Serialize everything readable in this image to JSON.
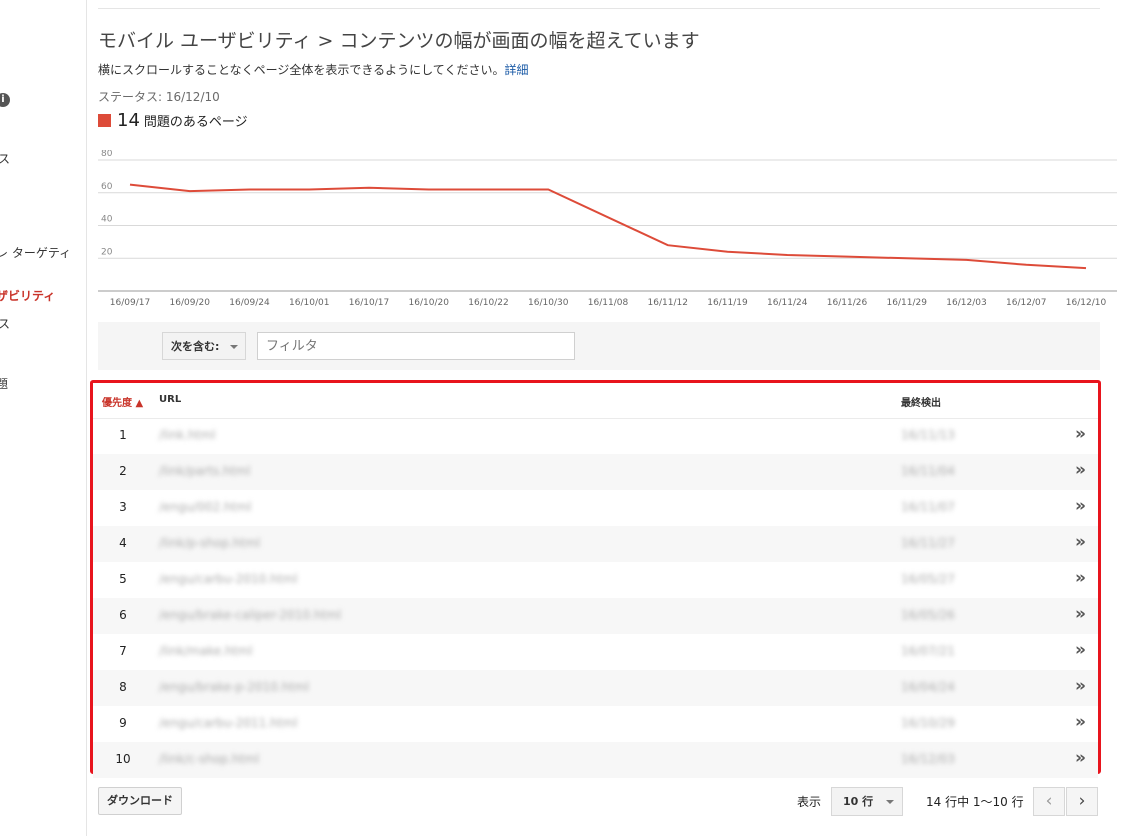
{
  "sidebar": {
    "items": [
      {
        "label": "ス"
      },
      {
        "label": "レ ターゲティ"
      },
      {
        "label": "ザビリティ"
      },
      {
        "label": "ス"
      },
      {
        "label": "題"
      }
    ]
  },
  "page": {
    "title": "モバイル ユーザビリティ > コンテンツの幅が画面の幅を超えています",
    "description": "横にスクロールすることなくページ全体を表示できるようにしてください。",
    "details_link": "詳細",
    "status": "ステータス: 16/12/10",
    "issue_count": "14",
    "issue_label": "問題のあるページ",
    "issue_color": "#dd4b39"
  },
  "chart_data": {
    "type": "line",
    "x": [
      "16/09/17",
      "16/09/20",
      "16/09/24",
      "16/10/01",
      "16/10/17",
      "16/10/20",
      "16/10/22",
      "16/10/30",
      "16/11/08",
      "16/11/12",
      "16/11/19",
      "16/11/24",
      "16/11/26",
      "16/11/29",
      "16/12/03",
      "16/12/07",
      "16/12/10"
    ],
    "series": [
      {
        "values": [
          65,
          61,
          62,
          62,
          63,
          62,
          62,
          62,
          null,
          28,
          24,
          22,
          21,
          20,
          19,
          16,
          14
        ]
      }
    ],
    "yticks": [
      20,
      40,
      60,
      80
    ],
    "ylim": [
      0,
      80
    ],
    "grid": true,
    "color": "#dd4b39"
  },
  "filter": {
    "select_label": "次を含む:",
    "input_placeholder": "フィルタ"
  },
  "table": {
    "columns": {
      "priority": "優先度 ▲",
      "url": "URL",
      "last_detected": "最終検出"
    },
    "rows": [
      {
        "priority": "1",
        "url": "/link.html",
        "date": "16/11/13"
      },
      {
        "priority": "2",
        "url": "/link/parts.html",
        "date": "16/11/04"
      },
      {
        "priority": "3",
        "url": "/engu/002.html",
        "date": "16/11/07"
      },
      {
        "priority": "4",
        "url": "/link/p-shop.html",
        "date": "16/11/27"
      },
      {
        "priority": "5",
        "url": "/engu/carbu-2010.html",
        "date": "16/05/27"
      },
      {
        "priority": "6",
        "url": "/engu/brake-caliper-2010.html",
        "date": "16/05/26"
      },
      {
        "priority": "7",
        "url": "/link/make.html",
        "date": "16/07/21"
      },
      {
        "priority": "8",
        "url": "/engu/brake-p-2010.html",
        "date": "16/04/24"
      },
      {
        "priority": "9",
        "url": "/engu/carbu-2011.html",
        "date": "16/10/29"
      },
      {
        "priority": "10",
        "url": "/link/c-shop.html",
        "date": "16/12/03"
      }
    ],
    "row_action_icon": "double-chevron-right-icon",
    "row_action_glyph": "»"
  },
  "footer": {
    "download_label": "ダウンロード",
    "show_label": "表示",
    "rows_per_page": "10 行",
    "page_info": "14 行中 1～10 行",
    "prev_glyph": "‹",
    "next_glyph": "›"
  }
}
